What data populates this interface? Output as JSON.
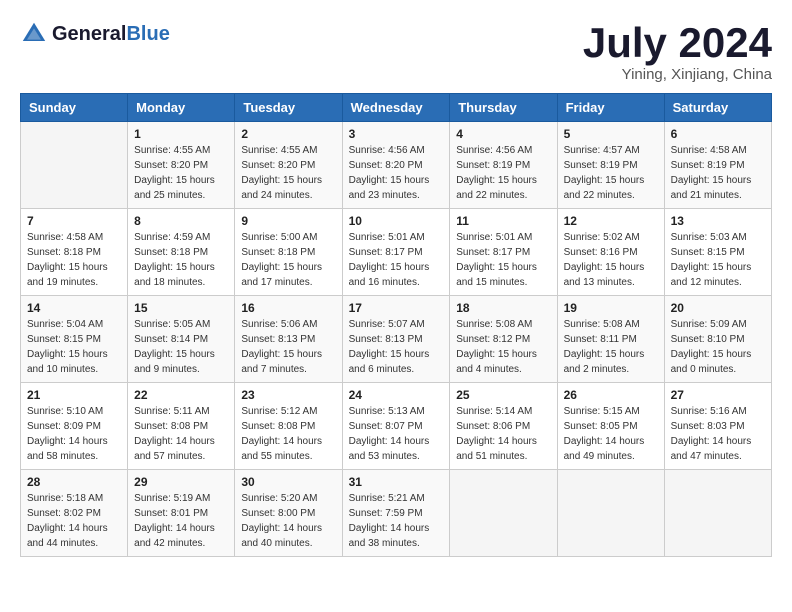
{
  "header": {
    "logo_general": "General",
    "logo_blue": "Blue",
    "month_title": "July 2024",
    "location": "Yining, Xinjiang, China"
  },
  "weekdays": [
    "Sunday",
    "Monday",
    "Tuesday",
    "Wednesday",
    "Thursday",
    "Friday",
    "Saturday"
  ],
  "weeks": [
    [
      {
        "day": "",
        "info": ""
      },
      {
        "day": "1",
        "info": "Sunrise: 4:55 AM\nSunset: 8:20 PM\nDaylight: 15 hours\nand 25 minutes."
      },
      {
        "day": "2",
        "info": "Sunrise: 4:55 AM\nSunset: 8:20 PM\nDaylight: 15 hours\nand 24 minutes."
      },
      {
        "day": "3",
        "info": "Sunrise: 4:56 AM\nSunset: 8:20 PM\nDaylight: 15 hours\nand 23 minutes."
      },
      {
        "day": "4",
        "info": "Sunrise: 4:56 AM\nSunset: 8:19 PM\nDaylight: 15 hours\nand 22 minutes."
      },
      {
        "day": "5",
        "info": "Sunrise: 4:57 AM\nSunset: 8:19 PM\nDaylight: 15 hours\nand 22 minutes."
      },
      {
        "day": "6",
        "info": "Sunrise: 4:58 AM\nSunset: 8:19 PM\nDaylight: 15 hours\nand 21 minutes."
      }
    ],
    [
      {
        "day": "7",
        "info": "Sunrise: 4:58 AM\nSunset: 8:18 PM\nDaylight: 15 hours\nand 19 minutes."
      },
      {
        "day": "8",
        "info": "Sunrise: 4:59 AM\nSunset: 8:18 PM\nDaylight: 15 hours\nand 18 minutes."
      },
      {
        "day": "9",
        "info": "Sunrise: 5:00 AM\nSunset: 8:18 PM\nDaylight: 15 hours\nand 17 minutes."
      },
      {
        "day": "10",
        "info": "Sunrise: 5:01 AM\nSunset: 8:17 PM\nDaylight: 15 hours\nand 16 minutes."
      },
      {
        "day": "11",
        "info": "Sunrise: 5:01 AM\nSunset: 8:17 PM\nDaylight: 15 hours\nand 15 minutes."
      },
      {
        "day": "12",
        "info": "Sunrise: 5:02 AM\nSunset: 8:16 PM\nDaylight: 15 hours\nand 13 minutes."
      },
      {
        "day": "13",
        "info": "Sunrise: 5:03 AM\nSunset: 8:15 PM\nDaylight: 15 hours\nand 12 minutes."
      }
    ],
    [
      {
        "day": "14",
        "info": "Sunrise: 5:04 AM\nSunset: 8:15 PM\nDaylight: 15 hours\nand 10 minutes."
      },
      {
        "day": "15",
        "info": "Sunrise: 5:05 AM\nSunset: 8:14 PM\nDaylight: 15 hours\nand 9 minutes."
      },
      {
        "day": "16",
        "info": "Sunrise: 5:06 AM\nSunset: 8:13 PM\nDaylight: 15 hours\nand 7 minutes."
      },
      {
        "day": "17",
        "info": "Sunrise: 5:07 AM\nSunset: 8:13 PM\nDaylight: 15 hours\nand 6 minutes."
      },
      {
        "day": "18",
        "info": "Sunrise: 5:08 AM\nSunset: 8:12 PM\nDaylight: 15 hours\nand 4 minutes."
      },
      {
        "day": "19",
        "info": "Sunrise: 5:08 AM\nSunset: 8:11 PM\nDaylight: 15 hours\nand 2 minutes."
      },
      {
        "day": "20",
        "info": "Sunrise: 5:09 AM\nSunset: 8:10 PM\nDaylight: 15 hours\nand 0 minutes."
      }
    ],
    [
      {
        "day": "21",
        "info": "Sunrise: 5:10 AM\nSunset: 8:09 PM\nDaylight: 14 hours\nand 58 minutes."
      },
      {
        "day": "22",
        "info": "Sunrise: 5:11 AM\nSunset: 8:08 PM\nDaylight: 14 hours\nand 57 minutes."
      },
      {
        "day": "23",
        "info": "Sunrise: 5:12 AM\nSunset: 8:08 PM\nDaylight: 14 hours\nand 55 minutes."
      },
      {
        "day": "24",
        "info": "Sunrise: 5:13 AM\nSunset: 8:07 PM\nDaylight: 14 hours\nand 53 minutes."
      },
      {
        "day": "25",
        "info": "Sunrise: 5:14 AM\nSunset: 8:06 PM\nDaylight: 14 hours\nand 51 minutes."
      },
      {
        "day": "26",
        "info": "Sunrise: 5:15 AM\nSunset: 8:05 PM\nDaylight: 14 hours\nand 49 minutes."
      },
      {
        "day": "27",
        "info": "Sunrise: 5:16 AM\nSunset: 8:03 PM\nDaylight: 14 hours\nand 47 minutes."
      }
    ],
    [
      {
        "day": "28",
        "info": "Sunrise: 5:18 AM\nSunset: 8:02 PM\nDaylight: 14 hours\nand 44 minutes."
      },
      {
        "day": "29",
        "info": "Sunrise: 5:19 AM\nSunset: 8:01 PM\nDaylight: 14 hours\nand 42 minutes."
      },
      {
        "day": "30",
        "info": "Sunrise: 5:20 AM\nSunset: 8:00 PM\nDaylight: 14 hours\nand 40 minutes."
      },
      {
        "day": "31",
        "info": "Sunrise: 5:21 AM\nSunset: 7:59 PM\nDaylight: 14 hours\nand 38 minutes."
      },
      {
        "day": "",
        "info": ""
      },
      {
        "day": "",
        "info": ""
      },
      {
        "day": "",
        "info": ""
      }
    ]
  ]
}
